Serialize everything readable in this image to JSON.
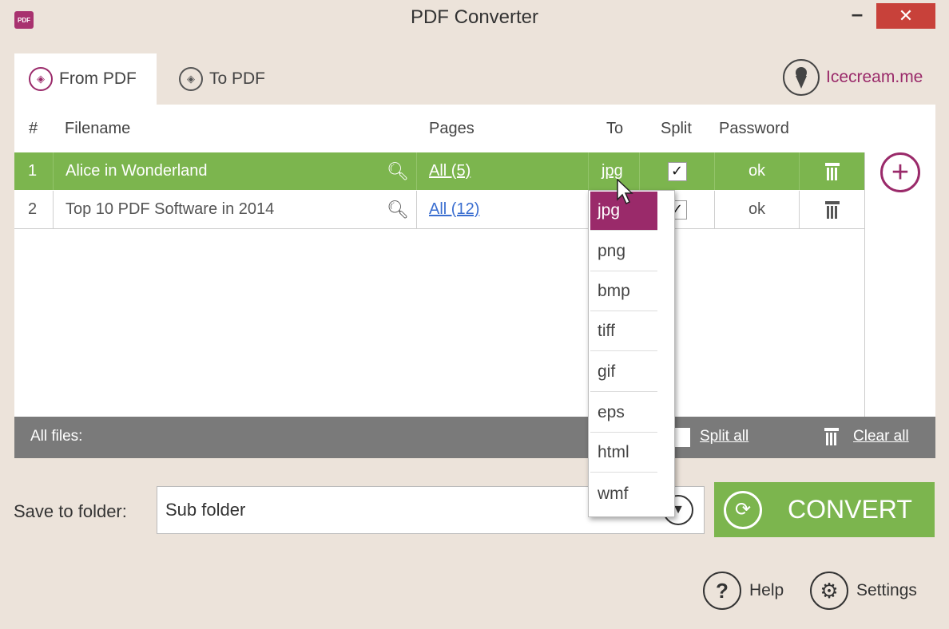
{
  "window": {
    "title": "PDF Converter",
    "app_icon_text": "PDF",
    "minimize": "–",
    "close": "✕"
  },
  "tabs": [
    {
      "label": "From PDF",
      "active": true
    },
    {
      "label": "To PDF",
      "active": false
    }
  ],
  "brand": {
    "label": "Icecream.me"
  },
  "table": {
    "headers": {
      "num": "#",
      "filename": "Filename",
      "pages": "Pages",
      "to": "To",
      "split": "Split",
      "password": "Password"
    },
    "rows": [
      {
        "num": "1",
        "filename": "Alice in Wonderland",
        "pages": "All (5)",
        "to": "jpg",
        "split": true,
        "password": "ok",
        "selected": true
      },
      {
        "num": "2",
        "filename": "Top 10 PDF Software in 2014",
        "pages": "All (12)",
        "to": "jpg",
        "split": true,
        "password": "ok",
        "selected": false
      }
    ]
  },
  "footer": {
    "all_files": "All files:",
    "split_all": "Split all",
    "clear_all": "Clear all"
  },
  "save": {
    "label": "Save to folder:",
    "value": "Sub folder"
  },
  "convert": {
    "label": "CONVERT"
  },
  "help": {
    "label": "Help"
  },
  "settings": {
    "label": "Settings"
  },
  "format_dropdown": {
    "options": [
      "jpg",
      "png",
      "bmp",
      "tiff",
      "gif",
      "eps",
      "html",
      "wmf"
    ],
    "selected": "jpg"
  },
  "colors": {
    "accent": "#9a2a6a",
    "green": "#7cb54e",
    "footer": "#7a7a7a",
    "close": "#c8413a"
  }
}
